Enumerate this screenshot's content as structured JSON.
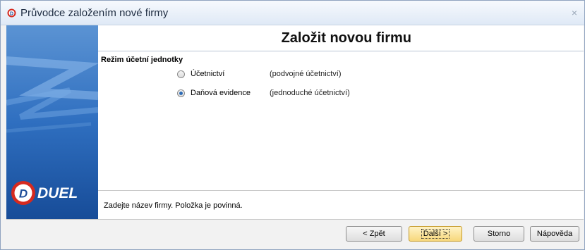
{
  "window": {
    "title": "Průvodce založením nové firmy",
    "close": "×"
  },
  "sidebar": {
    "logo_text": "DUEL",
    "logo_letter": "D"
  },
  "content": {
    "heading": "Založit novou firmu",
    "group_label": "Režim účetní jednotky",
    "options": [
      {
        "label": "Účetnictví",
        "note": "(podvojné účetnictví)",
        "selected": false
      },
      {
        "label": "Daňová evidence",
        "note": "(jednoduché účetnictví)",
        "selected": true
      }
    ],
    "hint": "Zadejte název firmy. Položka je povinná."
  },
  "buttons": {
    "back": "< Zpět",
    "next": "Další >",
    "cancel": "Storno",
    "help": "Nápověda"
  },
  "colors": {
    "accent_red": "#d62a1f",
    "sidebar_blue": "#1f5aa8"
  }
}
